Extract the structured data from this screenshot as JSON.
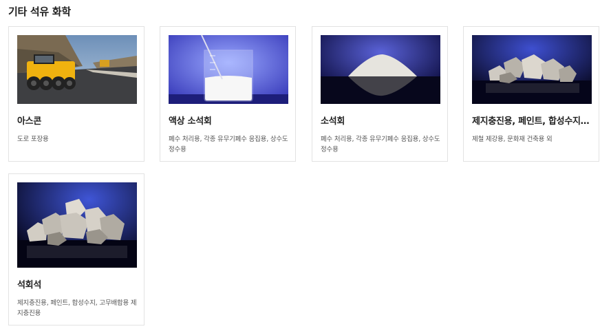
{
  "section": {
    "title": "기타 석유 화학"
  },
  "products": [
    {
      "name": "아스콘",
      "description": "도로 포장용",
      "image": "asphalt-roller-photo"
    },
    {
      "name": "액상 소석회",
      "description": "폐수 처리용, 각종 유무기폐수 응집용, 상수도 정수용",
      "image": "liquid-lime-beaker-photo"
    },
    {
      "name": "소석회",
      "description": "폐수 처리용, 각종 유무기폐수 응집용, 상수도 정수용",
      "image": "lime-powder-pile-photo"
    },
    {
      "name": "제지충진용, 페인트, 합성수지, 고무배합용",
      "description": "제철 제강용, 문화재 건축용 외",
      "image": "limestone-chunks-photo"
    },
    {
      "name": "석회석",
      "description": "제지충진용, 페인트, 합성수지, 고무배합용 제지충진용",
      "image": "limestone-rocks-photo"
    }
  ]
}
